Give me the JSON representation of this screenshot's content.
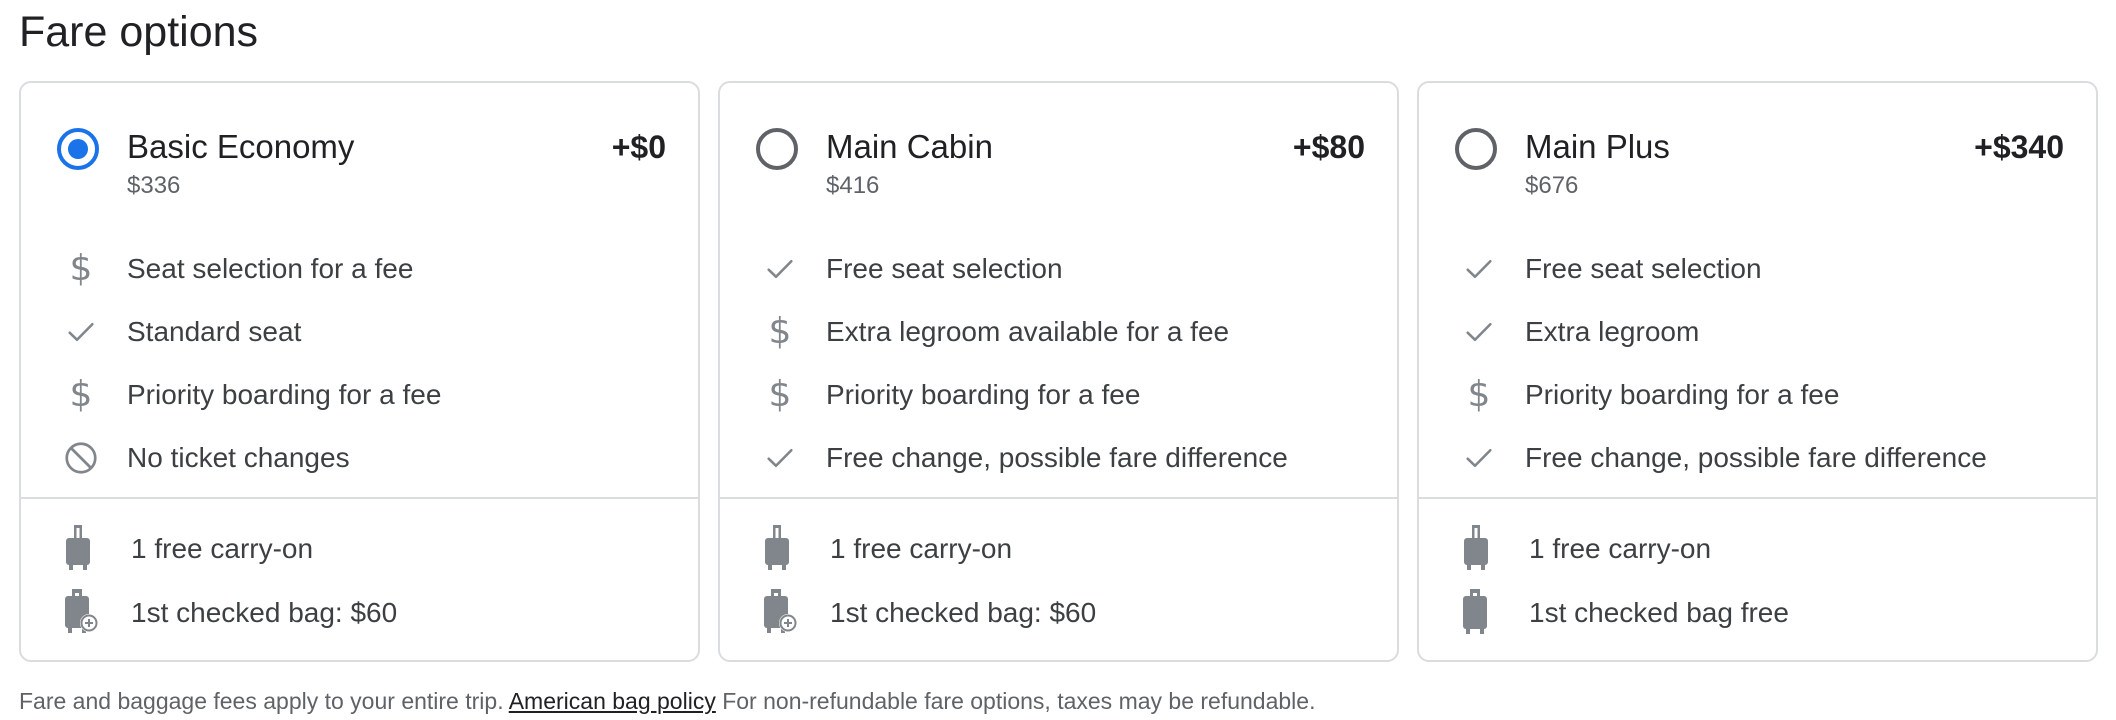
{
  "section": {
    "title": "Fare options"
  },
  "colors": {
    "accent": "#1a73e8",
    "icon_gray": "#80868b",
    "border": "#dadce0"
  },
  "fares": [
    {
      "name": "Basic Economy",
      "total": "$336",
      "delta": "+$0",
      "selected": true,
      "features": [
        {
          "icon": "dollar-icon",
          "text": "Seat selection for a fee"
        },
        {
          "icon": "check-icon",
          "text": "Standard seat"
        },
        {
          "icon": "dollar-icon",
          "text": "Priority boarding for a fee"
        },
        {
          "icon": "no-entry-icon",
          "text": "No ticket changes"
        }
      ],
      "bags": [
        {
          "icon": "carry-on-bag-icon",
          "text": "1 free carry-on"
        },
        {
          "icon": "checked-bag-fee-icon",
          "text": "1st checked bag: $60"
        }
      ]
    },
    {
      "name": "Main Cabin",
      "total": "$416",
      "delta": "+$80",
      "selected": false,
      "features": [
        {
          "icon": "check-icon",
          "text": "Free seat selection"
        },
        {
          "icon": "dollar-icon",
          "text": "Extra legroom available for a fee"
        },
        {
          "icon": "dollar-icon",
          "text": "Priority boarding for a fee"
        },
        {
          "icon": "check-icon",
          "text": "Free change, possible fare difference"
        }
      ],
      "bags": [
        {
          "icon": "carry-on-bag-icon",
          "text": "1 free carry-on"
        },
        {
          "icon": "checked-bag-fee-icon",
          "text": "1st checked bag: $60"
        }
      ]
    },
    {
      "name": "Main Plus",
      "total": "$676",
      "delta": "+$340",
      "selected": false,
      "features": [
        {
          "icon": "check-icon",
          "text": "Free seat selection"
        },
        {
          "icon": "check-icon",
          "text": "Extra legroom"
        },
        {
          "icon": "dollar-icon",
          "text": "Priority boarding for a fee"
        },
        {
          "icon": "check-icon",
          "text": "Free change, possible fare difference"
        }
      ],
      "bags": [
        {
          "icon": "carry-on-bag-icon",
          "text": "1 free carry-on"
        },
        {
          "icon": "checked-bag-icon",
          "text": "1st checked bag free"
        }
      ]
    }
  ],
  "footer": {
    "text_before": "Fare and baggage fees apply to your entire trip.",
    "link_text": "American bag policy",
    "text_after": "For non-refundable fare options, taxes may be refundable."
  }
}
